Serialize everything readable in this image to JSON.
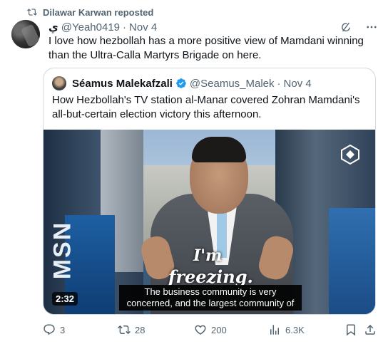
{
  "repost": {
    "label": "Dilawar Karwan reposted",
    "icon": "repost-icon"
  },
  "tweet": {
    "display_name": "ي",
    "handle": "@Yeah0419",
    "separator": "·",
    "date": "Nov 4",
    "text": "I love how hezbollah has a more positive view of Mamdani winning than the Ultra-Calla Martyrs Brigade on here."
  },
  "header_icons": [
    "grok-icon",
    "more-icon"
  ],
  "quote": {
    "display_name": "Séamus Malekafzali",
    "verified_color": "#1d9bf0",
    "handle": "@Seamus_Malek",
    "separator": "·",
    "date": "Nov 4",
    "text": "How Hezbollah's TV station al-Manar covered Zohran Mamdani's all-but-certain election victory this afternoon."
  },
  "video": {
    "overlay_line1": "I'm",
    "overlay_line2": "freezing.",
    "subtitle": "The business community is very concerned, and the largest community of",
    "duration": "2:32",
    "left_sign_text": "MSN"
  },
  "actions": {
    "replies": "3",
    "reposts": "28",
    "likes": "200",
    "views": "6.3K"
  },
  "colors": {
    "text": "#0f1419",
    "muted": "#536471",
    "border": "#cfd9de",
    "repost_green": "#00ba7c"
  }
}
